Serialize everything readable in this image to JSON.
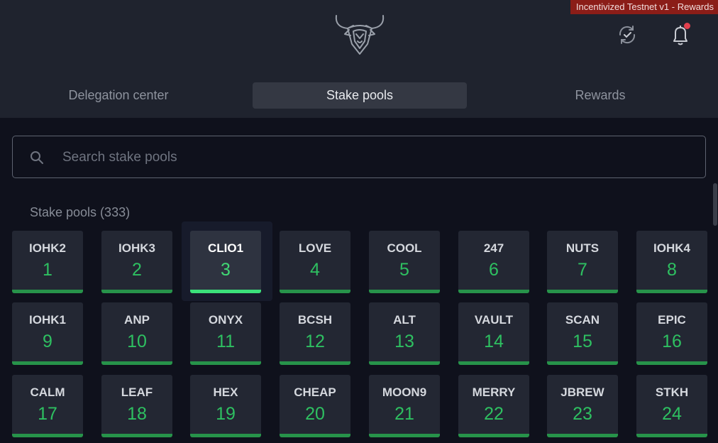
{
  "header": {
    "badge": "Incentivized Testnet v1 - Rewards",
    "logo_icon": "bull-logo-icon",
    "sync_icon": "sync-check-icon",
    "notification_icon": "bell-icon",
    "notification_dot_color": "#e2404e"
  },
  "tabs": [
    {
      "label": "Delegation center",
      "active": false
    },
    {
      "label": "Stake pools",
      "active": true
    },
    {
      "label": "Rewards",
      "active": false
    }
  ],
  "search": {
    "placeholder": "Search stake pools",
    "value": ""
  },
  "pools": {
    "title": "Stake pools (333)",
    "items": [
      {
        "ticker": "IOHK2",
        "rank": "1"
      },
      {
        "ticker": "IOHK3",
        "rank": "2"
      },
      {
        "ticker": "CLIO1",
        "rank": "3",
        "selected": true
      },
      {
        "ticker": "LOVE",
        "rank": "4"
      },
      {
        "ticker": "COOL",
        "rank": "5"
      },
      {
        "ticker": "247",
        "rank": "6"
      },
      {
        "ticker": "NUTS",
        "rank": "7"
      },
      {
        "ticker": "IOHK4",
        "rank": "8"
      },
      {
        "ticker": "IOHK1",
        "rank": "9"
      },
      {
        "ticker": "ANP",
        "rank": "10"
      },
      {
        "ticker": "ONYX",
        "rank": "11"
      },
      {
        "ticker": "BCSH",
        "rank": "12"
      },
      {
        "ticker": "ALT",
        "rank": "13"
      },
      {
        "ticker": "VAULT",
        "rank": "14"
      },
      {
        "ticker": "SCAN",
        "rank": "15"
      },
      {
        "ticker": "EPIC",
        "rank": "16"
      },
      {
        "ticker": "CALM",
        "rank": "17"
      },
      {
        "ticker": "LEAF",
        "rank": "18"
      },
      {
        "ticker": "HEX",
        "rank": "19"
      },
      {
        "ticker": "CHEAP",
        "rank": "20"
      },
      {
        "ticker": "MOON9",
        "rank": "21"
      },
      {
        "ticker": "MERRY",
        "rank": "22"
      },
      {
        "ticker": "JBREW",
        "rank": "23"
      },
      {
        "ticker": "STKH",
        "rank": "24"
      }
    ]
  },
  "colors": {
    "accent_green": "#2ec061",
    "background": "#0f111c",
    "header_bg": "#1f232e",
    "badge_bg": "#8b1d18"
  }
}
